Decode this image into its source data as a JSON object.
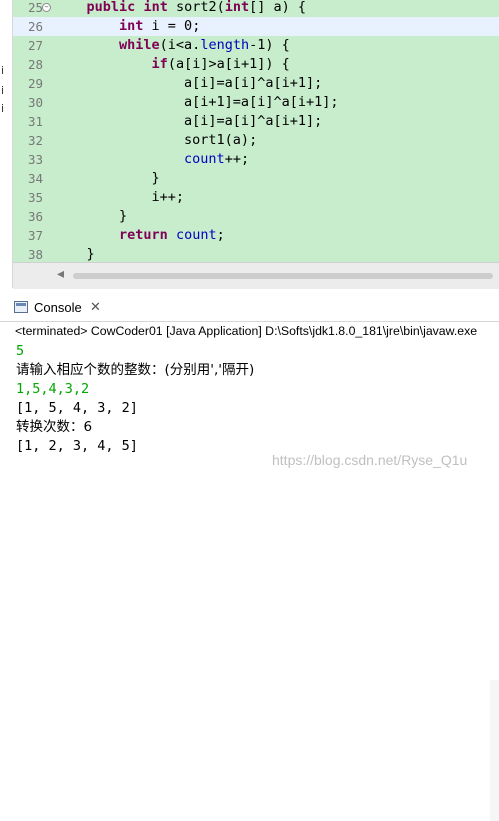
{
  "left_strip": {
    "fragments": [
      "i",
      "i",
      "i"
    ]
  },
  "editor": {
    "lines": [
      {
        "num": "25",
        "fold": true,
        "current": false,
        "segs": [
          [
            "    ",
            ""
          ],
          [
            "public",
            "kw"
          ],
          [
            " ",
            ""
          ],
          [
            "int",
            "kw"
          ],
          [
            " sort2(",
            ""
          ],
          [
            "int",
            "kw"
          ],
          [
            "[] a) {",
            ""
          ]
        ]
      },
      {
        "num": "26",
        "fold": false,
        "current": true,
        "segs": [
          [
            "        ",
            ""
          ],
          [
            "int",
            "kw"
          ],
          [
            " i = 0;",
            ""
          ]
        ]
      },
      {
        "num": "27",
        "fold": false,
        "current": false,
        "segs": [
          [
            "        ",
            ""
          ],
          [
            "while",
            "kw"
          ],
          [
            "(i<a.",
            ""
          ],
          [
            "length",
            "fld"
          ],
          [
            "-1) {",
            ""
          ]
        ]
      },
      {
        "num": "28",
        "fold": false,
        "current": false,
        "segs": [
          [
            "            ",
            ""
          ],
          [
            "if",
            "kw"
          ],
          [
            "(a[i]>a[i+1]) {",
            ""
          ]
        ]
      },
      {
        "num": "29",
        "fold": false,
        "current": false,
        "segs": [
          [
            "                a[i]=a[i]^a[i+1];",
            ""
          ]
        ]
      },
      {
        "num": "30",
        "fold": false,
        "current": false,
        "segs": [
          [
            "                a[i+1]=a[i]^a[i+1];",
            ""
          ]
        ]
      },
      {
        "num": "31",
        "fold": false,
        "current": false,
        "segs": [
          [
            "                a[i]=a[i]^a[i+1];",
            ""
          ]
        ]
      },
      {
        "num": "32",
        "fold": false,
        "current": false,
        "segs": [
          [
            "                sort1(a);",
            ""
          ]
        ]
      },
      {
        "num": "33",
        "fold": false,
        "current": false,
        "segs": [
          [
            "                ",
            ""
          ],
          [
            "count",
            "fld"
          ],
          [
            "++;",
            ""
          ]
        ]
      },
      {
        "num": "34",
        "fold": false,
        "current": false,
        "segs": [
          [
            "            }",
            ""
          ]
        ]
      },
      {
        "num": "35",
        "fold": false,
        "current": false,
        "segs": [
          [
            "            i++;",
            ""
          ]
        ]
      },
      {
        "num": "36",
        "fold": false,
        "current": false,
        "segs": [
          [
            "        }",
            ""
          ]
        ]
      },
      {
        "num": "37",
        "fold": false,
        "current": false,
        "segs": [
          [
            "        ",
            ""
          ],
          [
            "return",
            "kw"
          ],
          [
            " ",
            ""
          ],
          [
            "count",
            "fld"
          ],
          [
            ";",
            ""
          ]
        ]
      },
      {
        "num": "38",
        "fold": false,
        "current": false,
        "segs": [
          [
            "    }",
            ""
          ]
        ]
      }
    ]
  },
  "console": {
    "tab_label": "Console",
    "close_glyph": "✕",
    "status": "<terminated> CowCoder01 [Java Application] D:\\Softs\\jdk1.8.0_181\\jre\\bin\\javaw.exe",
    "output": [
      {
        "text": "5",
        "kind": "in"
      },
      {
        "text": "请输入相应个数的整数：(分别用','隔开)",
        "kind": "out"
      },
      {
        "text": "1,5,4,3,2",
        "kind": "in"
      },
      {
        "text": "[1, 5, 4, 3, 2]",
        "kind": "out"
      },
      {
        "text": "转换次数：6",
        "kind": "out"
      },
      {
        "text": "[1, 2, 3, 4, 5]",
        "kind": "out"
      }
    ]
  },
  "watermark": "https://blog.csdn.net/Ryse_Q1u",
  "colors": {
    "editor_bg": "#c7edcc",
    "keyword": "#7f0055",
    "field": "#0000c0",
    "input_text": "#00a800"
  }
}
